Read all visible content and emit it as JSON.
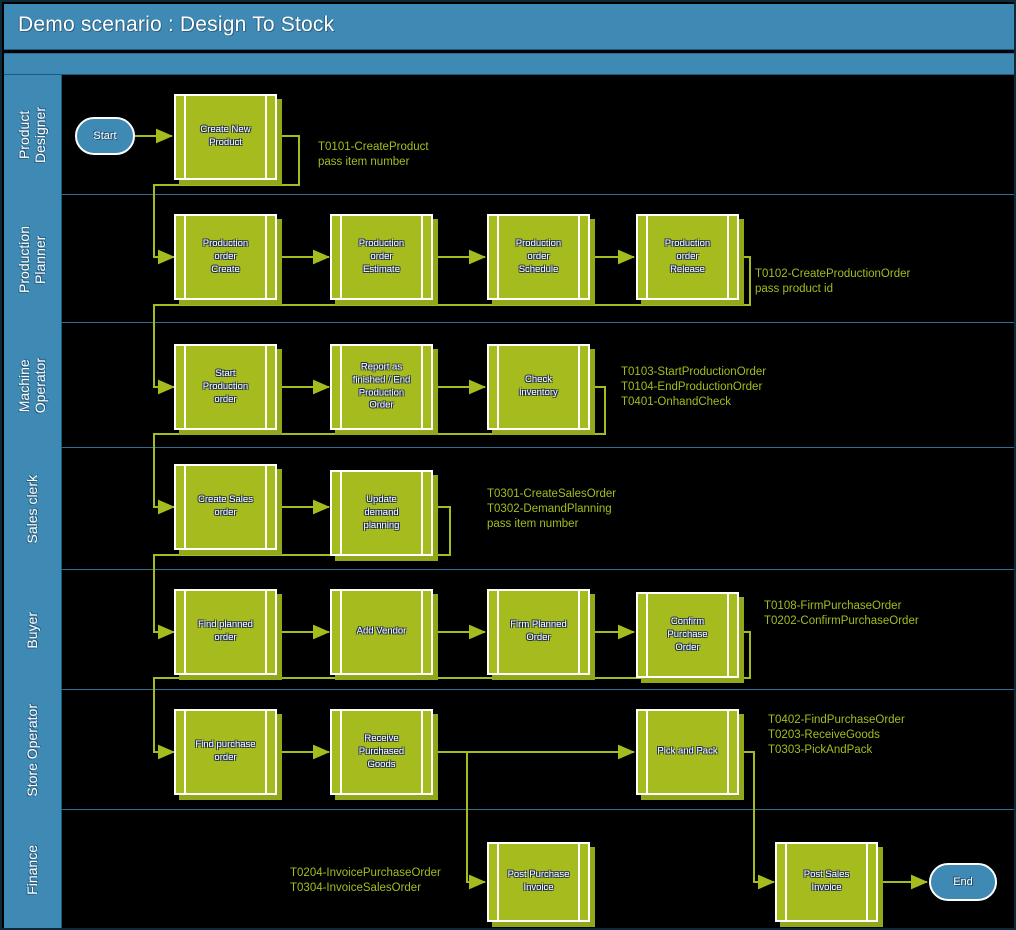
{
  "header": {
    "title": "Demo scenario : Design To Stock"
  },
  "colors": {
    "lane_blue": "#3f89b5",
    "node_green": "#a6bb1e",
    "connector_green": "#a6bb1e",
    "background": "#000000",
    "border": "#ffffff"
  },
  "terminators": {
    "start": "Start",
    "end": "End"
  },
  "lanes": [
    {
      "id": "product-designer",
      "label": "Product\nDesigner",
      "nodes": [
        {
          "id": "create-new-product",
          "label": "Create New\nProduct"
        }
      ],
      "annotations": [
        {
          "id": "a-t0101",
          "text": "T0101-CreateProduct\npass item number"
        }
      ]
    },
    {
      "id": "production-planner",
      "label": "Production\nPlanner",
      "nodes": [
        {
          "id": "production-order-create",
          "label": "Production\norder\nCreate"
        },
        {
          "id": "production-order-estimate",
          "label": "Production\norder\nEstimate"
        },
        {
          "id": "production-order-schedule",
          "label": "Production\norder\nSchedule"
        },
        {
          "id": "production-order-release",
          "label": "Production\norder\nRelease"
        }
      ],
      "annotations": [
        {
          "id": "a-t0102",
          "text": "T0102-CreateProductionOrder\npass product id"
        }
      ]
    },
    {
      "id": "machine-operator",
      "label": "Machine\nOperator",
      "nodes": [
        {
          "id": "start-production-order",
          "label": "Start\nProduction\norder"
        },
        {
          "id": "report-as-finished",
          "label": "Report as\nfinished / End\nProduction\nOrder"
        },
        {
          "id": "check-inventory",
          "label": "Check\ninventory"
        }
      ],
      "annotations": [
        {
          "id": "a-t0103",
          "text": "T0103-StartProductionOrder\nT0104-EndProductionOrder\nT0401-OnhandCheck"
        }
      ]
    },
    {
      "id": "sales-clerk",
      "label": "Sales clerk",
      "nodes": [
        {
          "id": "create-sales-order",
          "label": "Create Sales\norder"
        },
        {
          "id": "update-demand-planning",
          "label": "Update\ndemand\nplanning"
        }
      ],
      "annotations": [
        {
          "id": "a-t0301",
          "text": "T0301-CreateSalesOrder\nT0302-DemandPlanning\npass item number"
        }
      ]
    },
    {
      "id": "buyer",
      "label": "Buyer",
      "nodes": [
        {
          "id": "find-planned-order",
          "label": "Find planned\norder"
        },
        {
          "id": "add-vendor",
          "label": "Add Vendor"
        },
        {
          "id": "firm-planned-order",
          "label": "Firm Planned\nOrder"
        },
        {
          "id": "confirm-purchase-order",
          "label": "Confirm\nPurchase\nOrder"
        }
      ],
      "annotations": [
        {
          "id": "a-t0108",
          "text": "T0108-FirmPurchaseOrder\nT0202-ConfirmPurchaseOrder"
        }
      ]
    },
    {
      "id": "store-operator",
      "label": "Store Operator",
      "nodes": [
        {
          "id": "find-purchase-order",
          "label": "Find purchase\norder"
        },
        {
          "id": "receive-purchased-goods",
          "label": "Receive\nPurchased\nGoods"
        },
        {
          "id": "pick-and-pack",
          "label": "Pick and Pack"
        }
      ],
      "annotations": [
        {
          "id": "a-t0402",
          "text": "T0402-FindPurchaseOrder\nT0203-ReceiveGoods\nT0303-PickAndPack"
        }
      ]
    },
    {
      "id": "finance",
      "label": "Finance",
      "nodes": [
        {
          "id": "post-purchase-invoice",
          "label": "Post Purchase\nInvoice"
        },
        {
          "id": "post-sales-invoice",
          "label": "Post Sales\nInvoice"
        }
      ],
      "annotations": [
        {
          "id": "a-t0204",
          "text": "T0204-InvoicePurchaseOrder\nT0304-InvoiceSalesOrder"
        }
      ]
    }
  ]
}
